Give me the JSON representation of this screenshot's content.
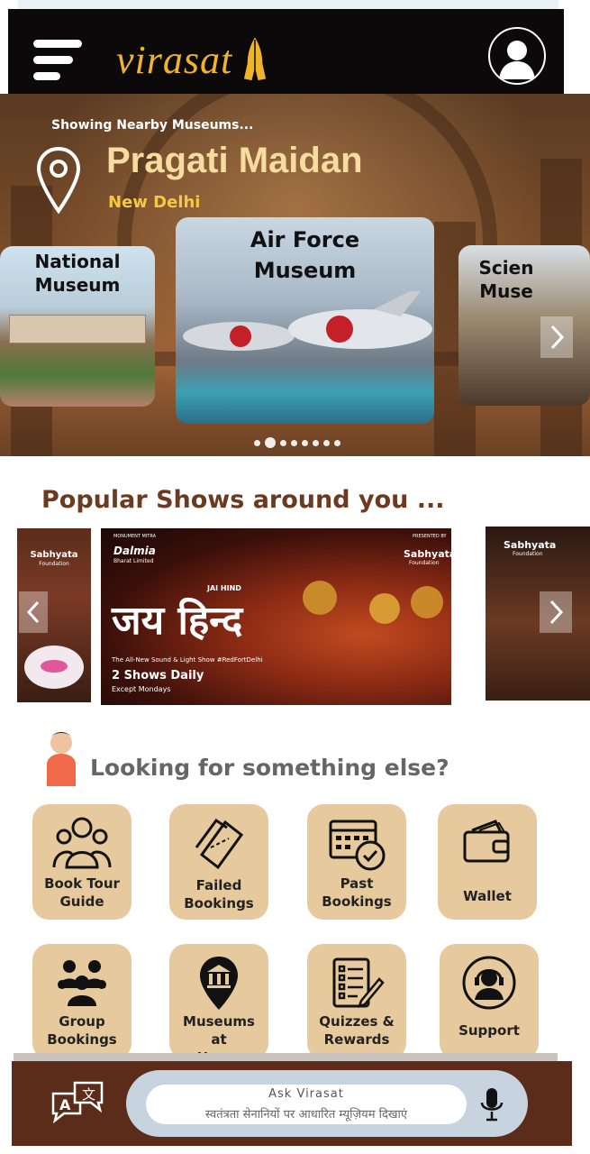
{
  "app": {
    "name": "Virasat"
  },
  "header": {
    "logo_text": "virasat",
    "menu_icon": "hamburger-menu-icon",
    "profile_icon": "user-avatar-icon"
  },
  "hero": {
    "showing": "Showing  Nearby Museums...",
    "location": "Pragati Maidan",
    "sublocation": "New Delhi",
    "cards": [
      {
        "label_line1": "National",
        "label_line2": "Museum"
      },
      {
        "label_line1": "Air Force",
        "label_line2": "Museum"
      },
      {
        "label_line1": "Scien",
        "label_line2": "Muse"
      }
    ],
    "page_count": 8,
    "active_page": 1
  },
  "shows": {
    "title": "Popular Shows around you ...",
    "main": {
      "sponsor": "Dalmia",
      "sponsor_sub": "Bharat Limited",
      "presented_by": "Sabhyata",
      "presented_sub": "Foundation",
      "small_top": "MONUMENT MITRA",
      "small_right": "PRESENTED BY",
      "headline_en": "JAI HIND",
      "headline_hi": "जय हिन्द",
      "tagline": "The All-New Sound & Light Show #RedFortDelhi",
      "daily": "2 Shows Daily",
      "except": "Except Mondays"
    },
    "left_logo": "Sabhyata",
    "left_logo_sub": "Foundation",
    "right_logo": "Sabhyata",
    "right_logo_sub": "Foundation"
  },
  "looking": {
    "title": "Looking for something else?"
  },
  "tiles": [
    {
      "line1": "Book Tour",
      "line2": "Guide",
      "icon": "tour-guide-group-icon"
    },
    {
      "line1": "Failed",
      "line2": "Bookings",
      "icon": "ticket-icon"
    },
    {
      "line1": "Past",
      "line2": "Bookings",
      "icon": "calendar-check-icon"
    },
    {
      "line1": "Wallet",
      "line2": "",
      "icon": "wallet-icon"
    },
    {
      "line1": "Group",
      "line2": "Bookings",
      "icon": "group-icon"
    },
    {
      "line1": "Museums at",
      "line2": "Home",
      "icon": "museum-pin-icon"
    },
    {
      "line1": "Quizzes &",
      "line2": "Rewards",
      "icon": "quiz-checklist-icon"
    },
    {
      "line1": "Support",
      "line2": "",
      "icon": "headset-support-icon"
    }
  ],
  "bottom": {
    "ask_title": "Ask Virasat",
    "placeholder": "स्वतंत्रता सेनानियों पर आधारित म्यूज़ियम दिखाएं",
    "translate_icon": "translate-icon",
    "mic_icon": "microphone-icon"
  },
  "colors": {
    "header_bg": "#0b0909",
    "logo": "#f0b429",
    "tile_bg": "#e6c99c",
    "section_title": "#6b3a1f",
    "bottom_bar": "#5a2c19"
  }
}
